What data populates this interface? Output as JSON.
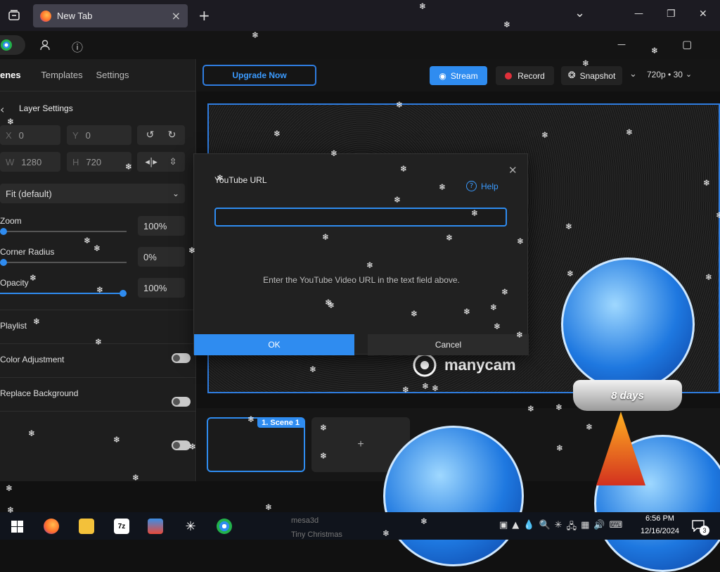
{
  "browser": {
    "tab_title": "New Tab",
    "close_icon": "×",
    "new_tab_icon": "+",
    "chevron": "⌄",
    "min": "—",
    "max": "❐",
    "close": "✕"
  },
  "app": {
    "info_icon": "ⓘ",
    "user_icon": "👤",
    "win_min": "—",
    "win_max": "▢"
  },
  "left_tabs": [
    "enes",
    "Templates",
    "Settings"
  ],
  "layer": {
    "back": "‹",
    "title": "Layer Settings",
    "x_label": "X",
    "x_value": "0",
    "y_label": "Y",
    "y_value": "0",
    "w_label": "W",
    "w_value": "1280",
    "h_label": "H",
    "h_value": "720",
    "fit": "Fit (default)",
    "zoom_label": "Zoom",
    "zoom_value": "100%",
    "zoom_level": 0,
    "radius_label": "Corner Radius",
    "radius_value": "0%",
    "radius_level": 0,
    "opacity_label": "Opacity",
    "opacity_value": "100%",
    "opacity_level": 1,
    "playlist": "Playlist",
    "color_adjust": "Color Adjustment",
    "replace_bg": "Replace Background"
  },
  "toolbar": {
    "upgrade": "Upgrade Now",
    "stream": "Stream",
    "record": "Record",
    "snapshot": "Snapshot",
    "resolution": "720p • 30"
  },
  "dialog": {
    "title": "YouTube URL",
    "help": "Help",
    "input_value": "",
    "hint": "Enter the YouTube Video URL in the text field above.",
    "ok": "OK",
    "cancel": "Cancel"
  },
  "preview": {
    "logo_text": "manycam"
  },
  "scenes": {
    "scene1": "1. Scene 1",
    "add": "+"
  },
  "decor": {
    "globe_text": "8 days"
  },
  "taskbar": {
    "time": "6:56 PM",
    "date": "12/16/2024",
    "notif_count": "3",
    "bg_text1": "mesa3d",
    "bg_text2": "Tiny Christmas"
  },
  "colors": {
    "accent": "#2f8cf0",
    "record_red": "#e0303a"
  }
}
